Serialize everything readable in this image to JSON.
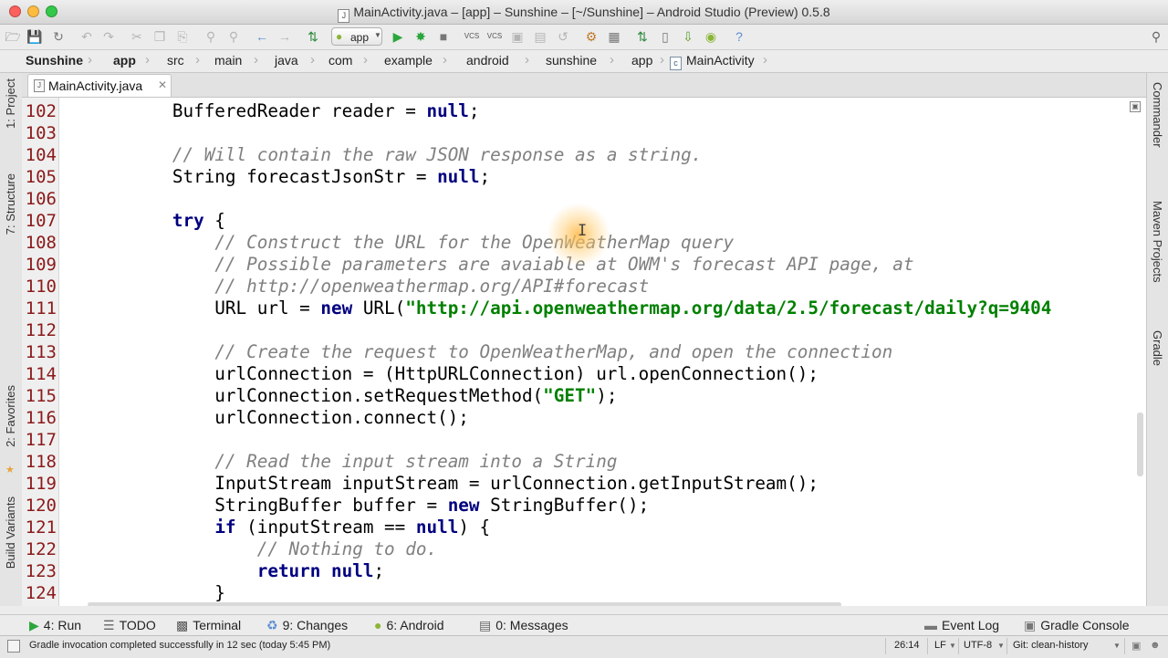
{
  "window": {
    "title": "MainActivity.java – [app] – Sunshine – [~/Sunshine] – Android Studio (Preview) 0.5.8"
  },
  "toolbar": {
    "run_config": "app"
  },
  "navbar": {
    "crumbs": [
      "Sunshine",
      "app",
      "src",
      "main",
      "java",
      "com",
      "example",
      "android",
      "sunshine",
      "app",
      "MainActivity"
    ]
  },
  "editor": {
    "tab_label": "MainActivity.java",
    "lines": [
      {
        "n": "102",
        "html": "        BufferedReader reader = <span class=\"kw\">null</span>;"
      },
      {
        "n": "103",
        "html": ""
      },
      {
        "n": "104",
        "html": "        <span class=\"cm\">// Will contain the raw JSON response as a string.</span>"
      },
      {
        "n": "105",
        "html": "        String forecastJsonStr = <span class=\"kw\">null</span>;"
      },
      {
        "n": "106",
        "html": ""
      },
      {
        "n": "107",
        "html": "        <span class=\"kw\">try</span> {"
      },
      {
        "n": "108",
        "html": "            <span class=\"cm\">// Construct the URL for the OpenWeatherMap query</span>"
      },
      {
        "n": "109",
        "html": "            <span class=\"cm\">// Possible parameters are avaiable at OWM's forecast API page, at</span>"
      },
      {
        "n": "110",
        "html": "            <span class=\"cm\">// http://openweathermap.org/API#forecast</span>"
      },
      {
        "n": "111",
        "html": "            URL url = <span class=\"kw\">new</span> URL(<span class=\"str\">\"http://api.openweathermap.org/data/2.5/forecast/daily?q=9404</span>"
      },
      {
        "n": "112",
        "html": ""
      },
      {
        "n": "113",
        "html": "            <span class=\"cm\">// Create the request to OpenWeatherMap, and open the connection</span>"
      },
      {
        "n": "114",
        "html": "            urlConnection = (HttpURLConnection) url.openConnection();"
      },
      {
        "n": "115",
        "html": "            urlConnection.setRequestMethod(<span class=\"str\">\"GET\"</span>);"
      },
      {
        "n": "116",
        "html": "            urlConnection.connect();"
      },
      {
        "n": "117",
        "html": ""
      },
      {
        "n": "118",
        "html": "            <span class=\"cm\">// Read the input stream into a String</span>"
      },
      {
        "n": "119",
        "html": "            InputStream inputStream = urlConnection.getInputStream();"
      },
      {
        "n": "120",
        "html": "            StringBuffer buffer = <span class=\"kw\">new</span> StringBuffer();"
      },
      {
        "n": "121",
        "html": "            <span class=\"kw\">if</span> (inputStream == <span class=\"kw\">null</span>) {"
      },
      {
        "n": "122",
        "html": "                <span class=\"cm\">// Nothing to do.</span>"
      },
      {
        "n": "123",
        "html": "                <span class=\"kw\">return null</span>;"
      },
      {
        "n": "124",
        "html": "            }"
      }
    ]
  },
  "left_tools": {
    "project": "1: Project",
    "structure": "7: Structure",
    "favorites": "2: Favorites",
    "build_variants": "Build Variants"
  },
  "right_tools": {
    "commander": "Commander",
    "maven": "Maven Projects",
    "gradle": "Gradle"
  },
  "tool_windows": {
    "run": "4: Run",
    "todo": "TODO",
    "terminal": "Terminal",
    "changes": "9: Changes",
    "android": "6: Android",
    "messages": "0: Messages",
    "event_log": "Event Log",
    "gradle_console": "Gradle Console"
  },
  "status": {
    "message": "Gradle invocation completed successfully in 12 sec (today 5:45 PM)",
    "position": "26:14",
    "line_sep": "LF",
    "encoding": "UTF-8",
    "vcs": "Git: clean-history"
  }
}
